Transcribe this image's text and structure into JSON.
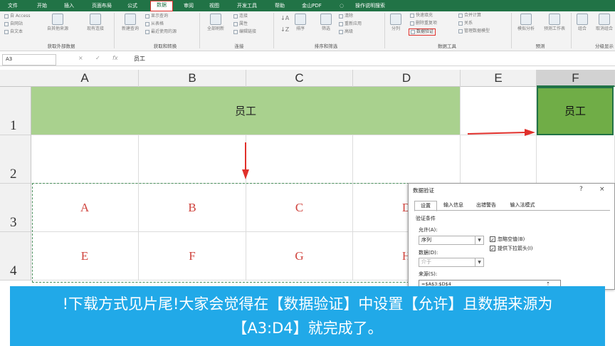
{
  "ribbon": {
    "tabs": [
      "文件",
      "开始",
      "插入",
      "页面布局",
      "公式",
      "数据",
      "审阅",
      "视图",
      "开发工具",
      "帮助",
      "金山PDF",
      "操作说明搜索"
    ],
    "active_tab": "数据",
    "get_external": {
      "access": "自 Access",
      "web": "自网站",
      "text": "自文本",
      "other": "自其他来源",
      "existing": "现有连接",
      "label": "获取外部数据"
    },
    "get_transform": {
      "new_query": "新建查询",
      "show_query": "显示查询",
      "from_table": "从表格",
      "recent": "最近使用的源",
      "label": "获取和转换"
    },
    "connections": {
      "refresh_all": "全部刷新",
      "connections": "连接",
      "properties": "属性",
      "edit_links": "编辑链接",
      "label": "连接"
    },
    "sort_filter": {
      "sort": "排序",
      "filter": "筛选",
      "clear": "清除",
      "reapply": "重新应用",
      "advanced": "高级",
      "label": "排序和筛选"
    },
    "data_tools": {
      "split": "分列",
      "flash_fill": "快速填充",
      "remove_dup": "删除重复项",
      "data_validation": "数据验证",
      "consolidate": "合并计算",
      "relationships": "关系",
      "manage_model": "管理数据模型",
      "label": "数据工具"
    },
    "forecast": {
      "what_if": "模拟分析",
      "forecast_sheet": "预测工作表",
      "label": "预测"
    },
    "outline": {
      "group": "组合",
      "ungroup": "取消组合",
      "label": "分级显示"
    }
  },
  "formula_bar": {
    "name_box": "A3",
    "cancel": "×",
    "enter": "✓",
    "fx": "fx",
    "value": "员工"
  },
  "columns": [
    "A",
    "B",
    "C",
    "D",
    "E",
    "F"
  ],
  "rows": [
    "1",
    "2",
    "3",
    "4"
  ],
  "cells": {
    "header_merged": "员工",
    "f1": "员工",
    "row3": [
      "A",
      "B",
      "C",
      "D"
    ],
    "row4": [
      "E",
      "F",
      "G",
      "H"
    ]
  },
  "dialog": {
    "title": "数据验证",
    "help": "?",
    "close": "×",
    "tabs": [
      "设置",
      "输入信息",
      "出错警告",
      "输入法模式"
    ],
    "criteria_label": "验证条件",
    "allow_label": "允许(A):",
    "allow_value": "序列",
    "data_label": "数据(D):",
    "data_value": "介于",
    "ignore_blank": "忽略空值(B)",
    "in_cell_dropdown": "提供下拉箭头(I)",
    "source_label": "来源(S):",
    "source_value": "=$A$3:$D$4"
  },
  "caption": {
    "line1": "!下载方式见片尾!大家会觉得在【数据验证】中设置【允许】且数据来源为",
    "line2": "【A3:D4】就完成了。"
  },
  "colors": {
    "excel_green": "#217346",
    "header_fill": "#a9d18e",
    "selected_fill": "#70ad47",
    "red_text": "#d0453f",
    "caption_bg": "#21a9e8",
    "arrow_red": "#e0302b"
  }
}
